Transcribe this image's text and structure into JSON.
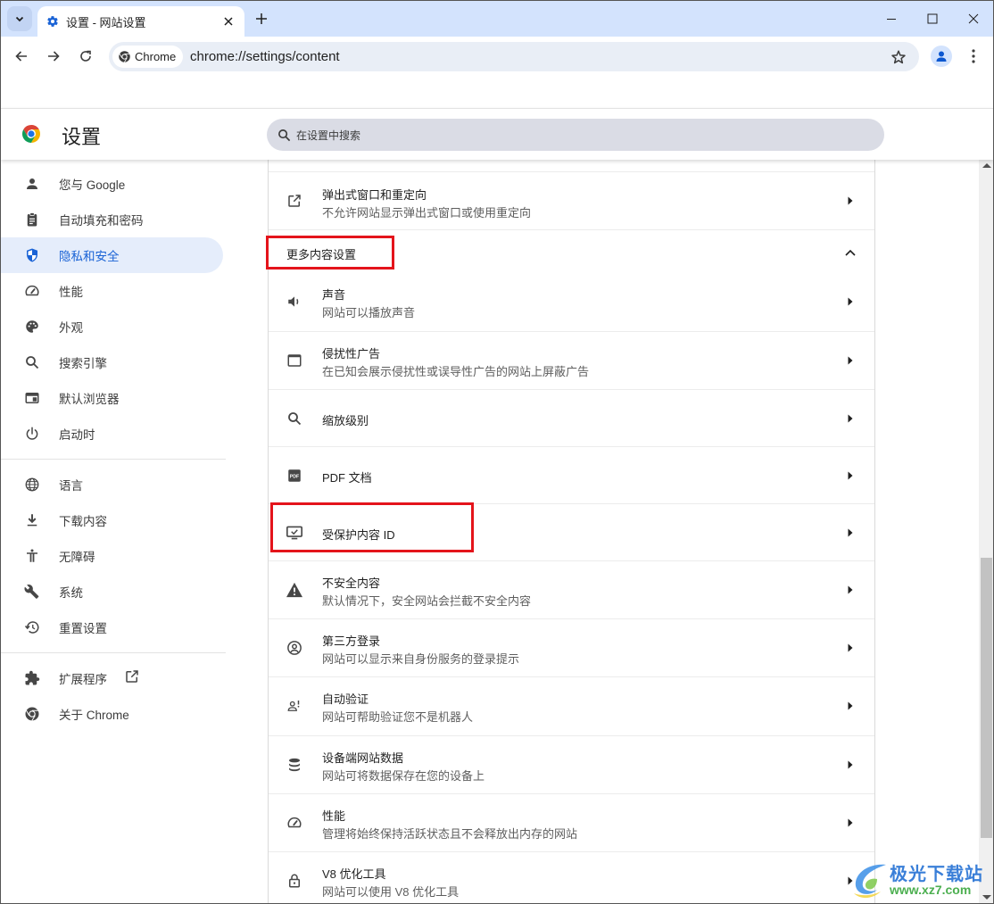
{
  "browser": {
    "tab_title": "设置 - 网站设置",
    "chip_label": "Chrome",
    "url": "chrome://settings/content"
  },
  "header": {
    "title": "设置",
    "search_placeholder": "在设置中搜索"
  },
  "sidebar": {
    "items": [
      {
        "label": "您与 Google",
        "icon": "person-icon"
      },
      {
        "label": "自动填充和密码",
        "icon": "clipboard-icon"
      },
      {
        "label": "隐私和安全",
        "icon": "shield-icon",
        "active": true
      },
      {
        "label": "性能",
        "icon": "speedometer-icon"
      },
      {
        "label": "外观",
        "icon": "palette-icon"
      },
      {
        "label": "搜索引擎",
        "icon": "search-icon"
      },
      {
        "label": "默认浏览器",
        "icon": "browser-window-icon"
      },
      {
        "label": "启动时",
        "icon": "power-icon"
      },
      {
        "label": "语言",
        "icon": "globe-icon"
      },
      {
        "label": "下载内容",
        "icon": "download-icon"
      },
      {
        "label": "无障碍",
        "icon": "accessibility-icon"
      },
      {
        "label": "系统",
        "icon": "wrench-icon"
      },
      {
        "label": "重置设置",
        "icon": "history-icon"
      },
      {
        "label": "扩展程序",
        "icon": "puzzle-icon"
      },
      {
        "label": "关于 Chrome",
        "icon": "chrome-icon"
      }
    ]
  },
  "content": {
    "popup_row": {
      "title": "弹出式窗口和重定向",
      "subtitle": "不允许网站显示弹出式窗口或使用重定向"
    },
    "section_title": "更多内容设置",
    "rows": [
      {
        "title": "声音",
        "subtitle": "网站可以播放声音",
        "icon": "speaker-icon"
      },
      {
        "title": "侵扰性广告",
        "subtitle": "在已知会展示侵扰性或误导性广告的网站上屏蔽广告",
        "icon": "ad-window-icon"
      },
      {
        "title": "缩放级别",
        "subtitle": "",
        "icon": "zoom-icon"
      },
      {
        "title": "PDF 文档",
        "subtitle": "",
        "icon": "pdf-icon"
      },
      {
        "title": "受保护内容 ID",
        "subtitle": "",
        "icon": "protected-content-icon"
      },
      {
        "title": "不安全内容",
        "subtitle": "默认情况下，安全网站会拦截不安全内容",
        "icon": "warning-icon"
      },
      {
        "title": "第三方登录",
        "subtitle": "网站可以显示来自身份服务的登录提示",
        "icon": "account-circle-icon"
      },
      {
        "title": "自动验证",
        "subtitle": "网站可帮助验证您不是机器人",
        "icon": "person-alert-icon"
      },
      {
        "title": "设备端网站数据",
        "subtitle": "网站可将数据保存在您的设备上",
        "icon": "database-icon"
      },
      {
        "title": "性能",
        "subtitle": "管理将始终保持活跃状态且不会释放出内存的网站",
        "icon": "speedometer-icon"
      },
      {
        "title": "V8 优化工具",
        "subtitle": "网站可以使用 V8 优化工具",
        "icon": "lock-icon"
      }
    ]
  },
  "watermark": {
    "name": "极光下载站",
    "url": "www.xz7.com"
  },
  "colors": {
    "accent": "#1a63d6",
    "tabstrip": "#d3e3fd",
    "active_nav": "#e5edfb",
    "highlight_box": "#e4141b"
  }
}
